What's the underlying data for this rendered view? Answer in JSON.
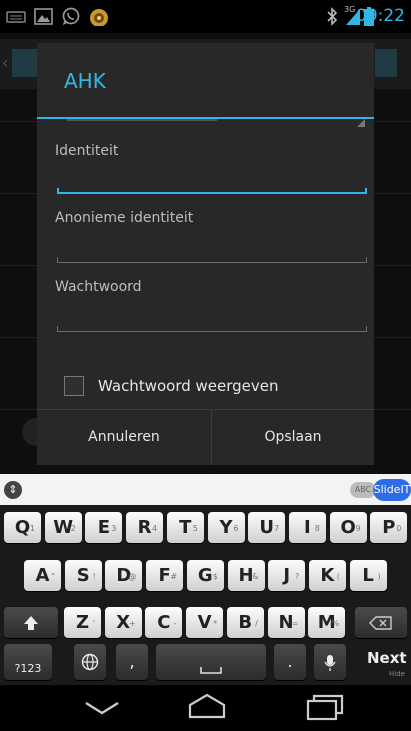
{
  "status_bar": {
    "time": "09:22",
    "network": "3G",
    "icons": [
      "keyboard-icon",
      "image-icon",
      "whatsapp-icon",
      "app-icon",
      "bluetooth-icon",
      "signal-icon",
      "battery-icon"
    ]
  },
  "dialog": {
    "title": "AHK",
    "fields": [
      {
        "label": "Identiteit",
        "value": ""
      },
      {
        "label": "Anonieme identiteit",
        "value": ""
      },
      {
        "label": "Wachtwoord",
        "value": ""
      }
    ],
    "checkbox_label": "Wachtwoord weergeven",
    "checkbox_checked": false,
    "cancel_label": "Annuleren",
    "save_label": "Opslaan"
  },
  "keyboard": {
    "abc_badge": "ABC",
    "slide_badge": "SlideIT",
    "row1": [
      "Q",
      "W",
      "E",
      "R",
      "T",
      "Y",
      "U",
      "I",
      "O",
      "P"
    ],
    "row1_sup": [
      "1",
      "2",
      "3",
      "4",
      "5",
      "6",
      "7",
      "8",
      "9",
      "0"
    ],
    "row2": [
      "A",
      "S",
      "D",
      "F",
      "G",
      "H",
      "J",
      "K",
      "L"
    ],
    "row2_sup": [
      "\"",
      "!",
      "@",
      "#",
      "$",
      "&",
      "?",
      "(",
      ")"
    ],
    "row3": [
      "Z",
      "X",
      "C",
      "V",
      "B",
      "N",
      "M"
    ],
    "row3_sup": [
      "'",
      "+",
      "-",
      "*",
      "/",
      "=",
      "%"
    ],
    "mode_label": "?123",
    "next_label": "Next",
    "hide_label": "Hide"
  },
  "nav": {
    "icons": [
      "back-icon",
      "home-icon",
      "recents-icon"
    ]
  }
}
